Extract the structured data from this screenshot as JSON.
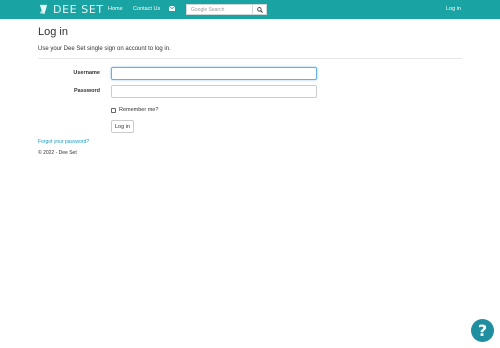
{
  "nav": {
    "brand": "DEE SET",
    "home": "Home",
    "contact": "Contact Us",
    "search_placeholder": "Google Search",
    "login": "Log in"
  },
  "page": {
    "title": "Log in",
    "subtitle": "Use your Dee Set single sign on account to log in."
  },
  "form": {
    "username_label": "Username",
    "username_value": "",
    "password_label": "Password",
    "password_value": "",
    "remember_label": "Remember me?",
    "remember_checked": false,
    "submit_label": "Log in"
  },
  "links": {
    "forgot": "Forgot your password?"
  },
  "footer": {
    "copyright": "© 2022 - Dee Set"
  },
  "help": {
    "glyph": "?"
  },
  "colors": {
    "navbar": "#1aa3a3",
    "link": "#1a9ec7",
    "help_button": "#1f8fa0"
  },
  "icons": {
    "brand": "dee-set-logo-icon",
    "mail": "mail-icon",
    "search": "search-icon",
    "help": "help-icon"
  }
}
